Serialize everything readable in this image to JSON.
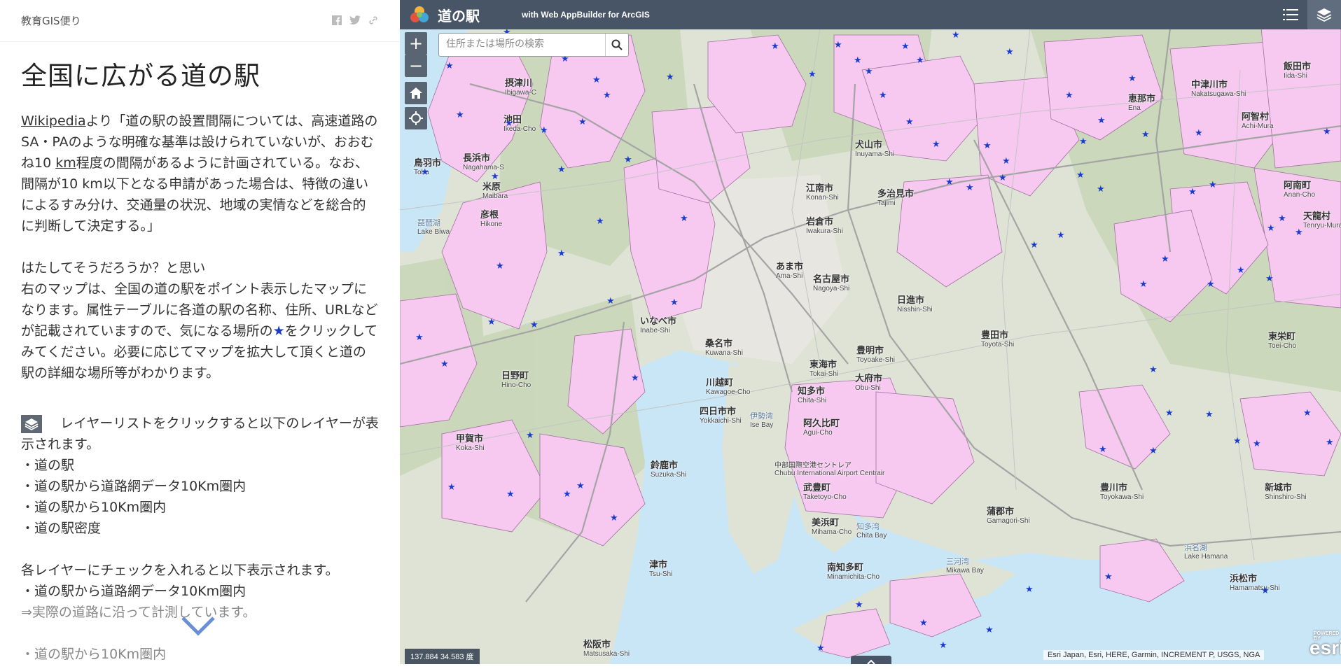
{
  "story": {
    "brand": "教育GIS便り",
    "title": "全国に広がる道の駅",
    "para1_link": "Wikipedia",
    "para1_a": "より「道の駅の設置間隔については、高速道路のSA・PAのような明確な基準は設けられていないが、おおむね10 ",
    "para1_km": "km",
    "para1_b": "程度の間隔があるように計画されている。なお、間隔が10 km以下となる申請があった場合は、特徴の違いによるすみ分け、交通量の状況、地域の実情などを総合的に判断して決定する。」",
    "para2_line1": "はたしてそうだろうか？と思い",
    "para2_a": "右のマップは、全国の道の駅をポイント表示したマップになります。属性テーブルに各道の駅の名称、住所、URLなどが記載されていますので、気になる場所の",
    "para2_star": "★",
    "para2_b": "をクリックしてみてください。必要に応じてマップを拡大して頂くと道の駅の詳細な場所等がわかります。",
    "para3_a": "レイヤーリストをクリックすると以下のレイヤーが表示されます。",
    "layers": [
      "・道の駅",
      "・道の駅から道路網データ10Km圏内",
      "・道の駅から10Km圏内",
      "・道の駅密度"
    ],
    "para4": "各レイヤーにチェックを入れると以下表示されます。",
    "para4_item": "・道の駅から道路網データ10Km圏内",
    "para4_note": "⇒実際の道路に沿って計測しています。",
    "para4_cut": "・道の駅から10Km圏内"
  },
  "app": {
    "title": "道の駅",
    "subtitle": "with Web AppBuilder for ArcGIS"
  },
  "search": {
    "placeholder": "住所または場所の検索"
  },
  "controls": {
    "zoom_in": "+",
    "zoom_out": "−"
  },
  "coords": "137.884 34.583 度",
  "attribution": "Esri Japan, Esri, HERE, Garmin, INCREMENT P, USGS, NGA",
  "esri": {
    "powered": "POWERED BY",
    "name": "esri"
  },
  "colors": {
    "header": "#485566",
    "buffer": "#f7c8f0",
    "star": "#1a3ccc",
    "water": "#c9e6f7",
    "land": "#dfe3d6"
  },
  "map_labels": [
    {
      "name": "摂津川",
      "romaji": "Ibigawa-C"
    },
    {
      "name": "池田",
      "romaji": "Ikeda-Cho"
    },
    {
      "name": "長浜市",
      "romaji": "Nagahama-S"
    },
    {
      "name": "米原",
      "romaji": "Maibara"
    },
    {
      "name": "彦根",
      "romaji": "Hikone"
    },
    {
      "name": "琵琶湖",
      "romaji": "Lake Biwa"
    },
    {
      "name": "江南市",
      "romaji": "Konan-Shi"
    },
    {
      "name": "岩倉市",
      "romaji": "Iwakura-Shi"
    },
    {
      "name": "あま市",
      "romaji": "Ama-Shi"
    },
    {
      "name": "名古屋市",
      "romaji": "Nagoya-Shi"
    },
    {
      "name": "いなべ市",
      "romaji": "Inabe-Shi"
    },
    {
      "name": "桑名市",
      "romaji": "Kuwana-Shi"
    },
    {
      "name": "日進市",
      "romaji": "Nisshin-Shi"
    },
    {
      "name": "豊田市",
      "romaji": "Toyota-Shi"
    },
    {
      "name": "豊明市",
      "romaji": "Toyoake-Shi"
    },
    {
      "name": "東海市",
      "romaji": "Tokai-Shi"
    },
    {
      "name": "大府市",
      "romaji": "Obu-Shi"
    },
    {
      "name": "川越町",
      "romaji": "Kawagoe-Cho"
    },
    {
      "name": "四日市市",
      "romaji": "Yokkaichi-Shi"
    },
    {
      "name": "知多市",
      "romaji": "Chita-Shi"
    },
    {
      "name": "阿久比町",
      "romaji": "Agui-Cho"
    },
    {
      "name": "日野町",
      "romaji": "Hino-Cho"
    },
    {
      "name": "甲賀市",
      "romaji": "Koka-Shi"
    },
    {
      "name": "鈴鹿市",
      "romaji": "Suzuka-Shi"
    },
    {
      "name": "武豊町",
      "romaji": "Taketoyo-Cho"
    },
    {
      "name": "美浜町",
      "romaji": "Mihama-Cho"
    },
    {
      "name": "南知多町",
      "romaji": "Minamichita-Cho"
    },
    {
      "name": "中部国際空港セントレア",
      "romaji": "Chubu International Airport Centrair"
    },
    {
      "name": "伊勢湾",
      "romaji": "Ise Bay"
    },
    {
      "name": "多治見市",
      "romaji": "Tajimi"
    },
    {
      "name": "犬山市",
      "romaji": "Inuyama-Shi"
    },
    {
      "name": "恵那市",
      "romaji": "Ena"
    },
    {
      "name": "中津川市",
      "romaji": "Nakatsugawa-Shi"
    },
    {
      "name": "飯田市",
      "romaji": "Iida-Shi"
    },
    {
      "name": "阿智村",
      "romaji": "Achi-Mura"
    },
    {
      "name": "阿南町",
      "romaji": "Anan-Cho"
    },
    {
      "name": "天龍村",
      "romaji": "Tenryu-Mura"
    },
    {
      "name": "豊川市",
      "romaji": "Toyokawa-Shi"
    },
    {
      "name": "蒲郡市",
      "romaji": "Gamagori-Shi"
    },
    {
      "name": "浜松市",
      "romaji": "Hamamatsu-Shi"
    },
    {
      "name": "新城市",
      "romaji": "Shinshiro-Shi"
    },
    {
      "name": "東栄町",
      "romaji": "Toei-Cho"
    },
    {
      "name": "松阪市",
      "romaji": "Matsusaka-Shi"
    },
    {
      "name": "津市",
      "romaji": "Tsu-Shi"
    },
    {
      "name": "知多湾",
      "romaji": "Chita Bay"
    },
    {
      "name": "三河湾",
      "romaji": "Mikawa Bay"
    },
    {
      "name": "浜名湖",
      "romaji": "Lake Hamana"
    },
    {
      "name": "鳥羽市",
      "romaji": "Toba"
    }
  ]
}
